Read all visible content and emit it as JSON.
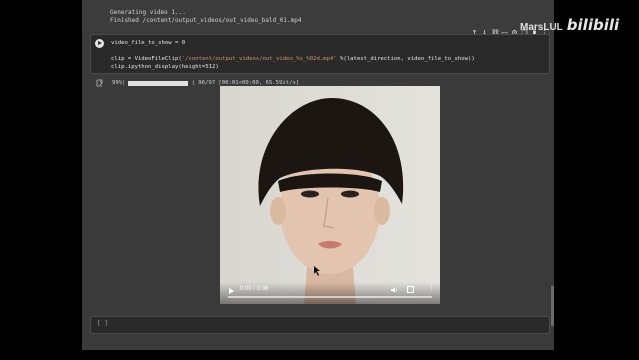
{
  "notebook": {
    "prev_output": {
      "line1": "Generating video 1...",
      "line2": "Finished /content/output_videos/out_video_bald_01.mp4"
    },
    "code_cell": {
      "line1": "video_file_to_show = 0",
      "line2_pre": "clip = VideoFileClip(",
      "line2_str": "'/content/output_videos/out_video_%s_%02d.mp4'",
      "line2_post": " %(latest_direction, video_file_to_show))",
      "line3": "clip.ipython_display(height=512)"
    },
    "toolbar_icons": [
      "arrow-up-icon",
      "arrow-down-icon",
      "link-icon",
      "comment-icon",
      "settings-icon",
      "copy-icon",
      "delete-icon",
      "more-icon"
    ],
    "progress": {
      "percent_label": "99%|",
      "fill_fraction": 0.99,
      "stats": "| 96/97 [00:01<00:00, 65.59it/s]"
    },
    "video": {
      "time": "0:00 / 0:08"
    },
    "empty_cell": {
      "bracket": "[ ]"
    }
  },
  "watermark": {
    "user": "MarsLUL",
    "logo": "bilibili"
  },
  "colors": {
    "background": "#000000",
    "notebook_bg": "#3a3a3a",
    "cell_bg": "#2a2a2a",
    "string": "#d88e6c"
  }
}
